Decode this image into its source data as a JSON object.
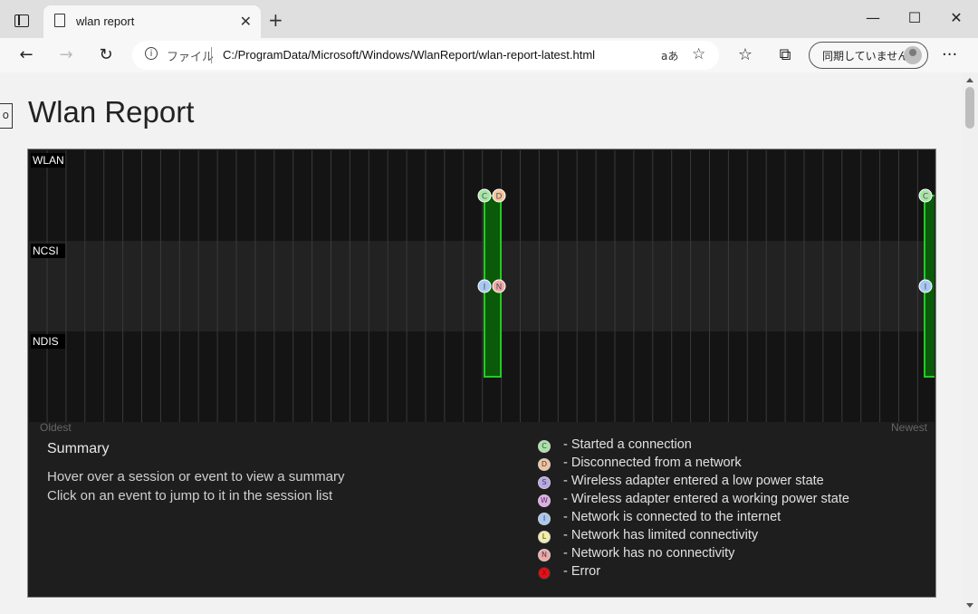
{
  "browser": {
    "tab": {
      "title": "wlan report",
      "close": "✕"
    },
    "new_tab": "+",
    "window": {
      "minimize": "—",
      "maximize": "☐",
      "close": "✕"
    },
    "nav": {
      "back": "←",
      "forward": "→",
      "reload": "↻"
    },
    "address": {
      "info": "i",
      "scheme_label": "ファイル",
      "url": "C:/ProgramData/Microsoft/Windows/WlanReport/wlan-report-latest.html",
      "read_aloud": "aあ"
    },
    "sync_label": "同期していません",
    "menu": "···"
  },
  "page": {
    "collapse_glyph": "o",
    "title": "Wlan Report"
  },
  "report": {
    "rows": [
      "WLAN",
      "NCSI",
      "NDIS"
    ],
    "oldest_label": "Oldest",
    "newest_label": "Newest",
    "events": [
      {
        "row": "WLAN",
        "letter": "C",
        "color": "#a7e4a6"
      },
      {
        "row": "WLAN",
        "letter": "D",
        "color": "#f3c49d"
      },
      {
        "row": "NCSI",
        "letter": "I",
        "color": "#a7c8f2"
      },
      {
        "row": "NCSI",
        "letter": "N",
        "color": "#f2a7a7"
      },
      {
        "row": "WLAN",
        "letter": "C",
        "color": "#a7e4a6"
      },
      {
        "row": "NCSI",
        "letter": "I",
        "color": "#a7c8f2"
      }
    ],
    "summary": {
      "title": "Summary",
      "lines": [
        "Hover over a session or event to view a summary",
        "Click on an event to jump to it in the session list"
      ]
    },
    "legend": [
      {
        "letter": "C",
        "color": "#a7e4a6",
        "text": "- Started a connection"
      },
      {
        "letter": "D",
        "color": "#f3c49d",
        "text": "- Disconnected from a network"
      },
      {
        "letter": "S",
        "color": "#b9a7e8",
        "text": "- Wireless adapter entered a low power state"
      },
      {
        "letter": "W",
        "color": "#e5a7ef",
        "text": "- Wireless adapter entered a working power state"
      },
      {
        "letter": "I",
        "color": "#a7c8f2",
        "text": "- Network is connected to the internet"
      },
      {
        "letter": "L",
        "color": "#f3efa7",
        "text": "- Network has limited connectivity"
      },
      {
        "letter": "N",
        "color": "#f2a7a7",
        "text": "- Network has no connectivity"
      },
      {
        "letter": "X",
        "color": "#e0121a",
        "text": "- Error"
      }
    ]
  }
}
